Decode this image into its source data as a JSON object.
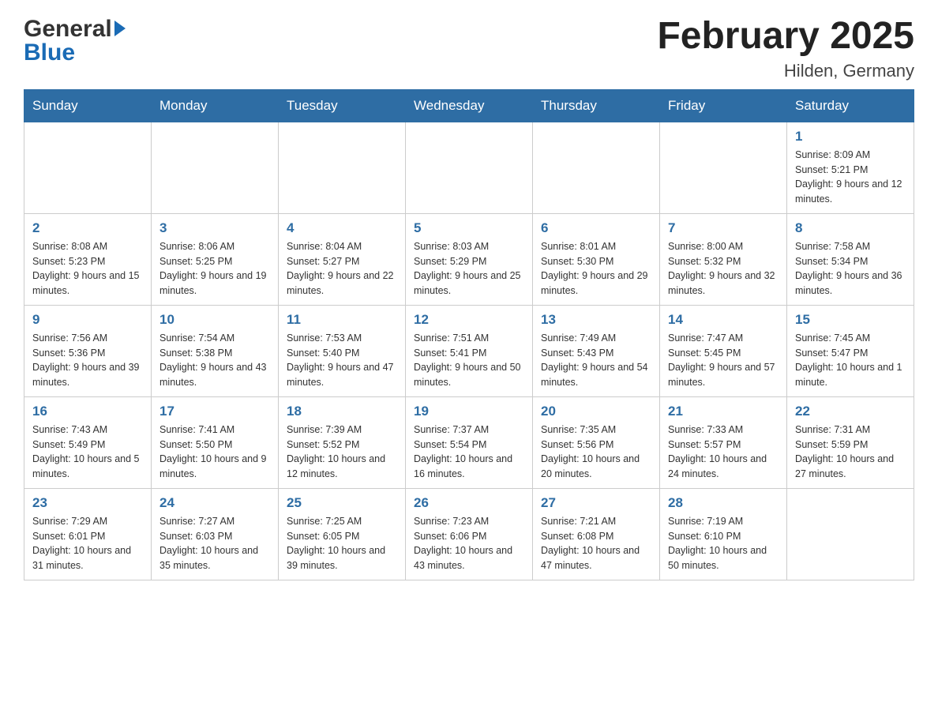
{
  "header": {
    "logo_general": "General",
    "logo_blue": "Blue",
    "month_title": "February 2025",
    "location": "Hilden, Germany"
  },
  "weekdays": [
    "Sunday",
    "Monday",
    "Tuesday",
    "Wednesday",
    "Thursday",
    "Friday",
    "Saturday"
  ],
  "weeks": [
    [
      {
        "day": "",
        "info": ""
      },
      {
        "day": "",
        "info": ""
      },
      {
        "day": "",
        "info": ""
      },
      {
        "day": "",
        "info": ""
      },
      {
        "day": "",
        "info": ""
      },
      {
        "day": "",
        "info": ""
      },
      {
        "day": "1",
        "info": "Sunrise: 8:09 AM\nSunset: 5:21 PM\nDaylight: 9 hours and 12 minutes."
      }
    ],
    [
      {
        "day": "2",
        "info": "Sunrise: 8:08 AM\nSunset: 5:23 PM\nDaylight: 9 hours and 15 minutes."
      },
      {
        "day": "3",
        "info": "Sunrise: 8:06 AM\nSunset: 5:25 PM\nDaylight: 9 hours and 19 minutes."
      },
      {
        "day": "4",
        "info": "Sunrise: 8:04 AM\nSunset: 5:27 PM\nDaylight: 9 hours and 22 minutes."
      },
      {
        "day": "5",
        "info": "Sunrise: 8:03 AM\nSunset: 5:29 PM\nDaylight: 9 hours and 25 minutes."
      },
      {
        "day": "6",
        "info": "Sunrise: 8:01 AM\nSunset: 5:30 PM\nDaylight: 9 hours and 29 minutes."
      },
      {
        "day": "7",
        "info": "Sunrise: 8:00 AM\nSunset: 5:32 PM\nDaylight: 9 hours and 32 minutes."
      },
      {
        "day": "8",
        "info": "Sunrise: 7:58 AM\nSunset: 5:34 PM\nDaylight: 9 hours and 36 minutes."
      }
    ],
    [
      {
        "day": "9",
        "info": "Sunrise: 7:56 AM\nSunset: 5:36 PM\nDaylight: 9 hours and 39 minutes."
      },
      {
        "day": "10",
        "info": "Sunrise: 7:54 AM\nSunset: 5:38 PM\nDaylight: 9 hours and 43 minutes."
      },
      {
        "day": "11",
        "info": "Sunrise: 7:53 AM\nSunset: 5:40 PM\nDaylight: 9 hours and 47 minutes."
      },
      {
        "day": "12",
        "info": "Sunrise: 7:51 AM\nSunset: 5:41 PM\nDaylight: 9 hours and 50 minutes."
      },
      {
        "day": "13",
        "info": "Sunrise: 7:49 AM\nSunset: 5:43 PM\nDaylight: 9 hours and 54 minutes."
      },
      {
        "day": "14",
        "info": "Sunrise: 7:47 AM\nSunset: 5:45 PM\nDaylight: 9 hours and 57 minutes."
      },
      {
        "day": "15",
        "info": "Sunrise: 7:45 AM\nSunset: 5:47 PM\nDaylight: 10 hours and 1 minute."
      }
    ],
    [
      {
        "day": "16",
        "info": "Sunrise: 7:43 AM\nSunset: 5:49 PM\nDaylight: 10 hours and 5 minutes."
      },
      {
        "day": "17",
        "info": "Sunrise: 7:41 AM\nSunset: 5:50 PM\nDaylight: 10 hours and 9 minutes."
      },
      {
        "day": "18",
        "info": "Sunrise: 7:39 AM\nSunset: 5:52 PM\nDaylight: 10 hours and 12 minutes."
      },
      {
        "day": "19",
        "info": "Sunrise: 7:37 AM\nSunset: 5:54 PM\nDaylight: 10 hours and 16 minutes."
      },
      {
        "day": "20",
        "info": "Sunrise: 7:35 AM\nSunset: 5:56 PM\nDaylight: 10 hours and 20 minutes."
      },
      {
        "day": "21",
        "info": "Sunrise: 7:33 AM\nSunset: 5:57 PM\nDaylight: 10 hours and 24 minutes."
      },
      {
        "day": "22",
        "info": "Sunrise: 7:31 AM\nSunset: 5:59 PM\nDaylight: 10 hours and 27 minutes."
      }
    ],
    [
      {
        "day": "23",
        "info": "Sunrise: 7:29 AM\nSunset: 6:01 PM\nDaylight: 10 hours and 31 minutes."
      },
      {
        "day": "24",
        "info": "Sunrise: 7:27 AM\nSunset: 6:03 PM\nDaylight: 10 hours and 35 minutes."
      },
      {
        "day": "25",
        "info": "Sunrise: 7:25 AM\nSunset: 6:05 PM\nDaylight: 10 hours and 39 minutes."
      },
      {
        "day": "26",
        "info": "Sunrise: 7:23 AM\nSunset: 6:06 PM\nDaylight: 10 hours and 43 minutes."
      },
      {
        "day": "27",
        "info": "Sunrise: 7:21 AM\nSunset: 6:08 PM\nDaylight: 10 hours and 47 minutes."
      },
      {
        "day": "28",
        "info": "Sunrise: 7:19 AM\nSunset: 6:10 PM\nDaylight: 10 hours and 50 minutes."
      },
      {
        "day": "",
        "info": ""
      }
    ]
  ]
}
